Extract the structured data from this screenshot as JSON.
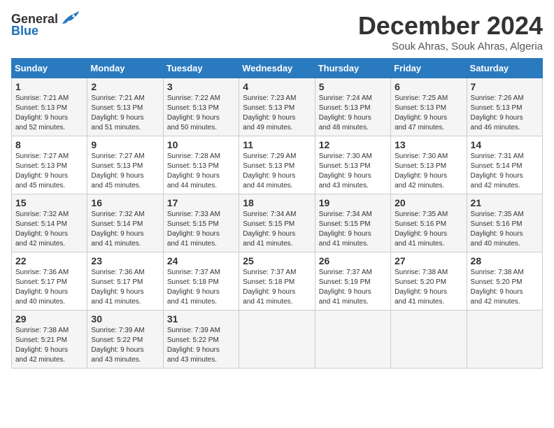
{
  "header": {
    "logo_general": "General",
    "logo_blue": "Blue",
    "month": "December 2024",
    "location": "Souk Ahras, Souk Ahras, Algeria"
  },
  "calendar": {
    "weekdays": [
      "Sunday",
      "Monday",
      "Tuesday",
      "Wednesday",
      "Thursday",
      "Friday",
      "Saturday"
    ],
    "weeks": [
      [
        {
          "day": "",
          "info": ""
        },
        {
          "day": "2",
          "info": "Sunrise: 7:21 AM\nSunset: 5:13 PM\nDaylight: 9 hours\nand 51 minutes."
        },
        {
          "day": "3",
          "info": "Sunrise: 7:22 AM\nSunset: 5:13 PM\nDaylight: 9 hours\nand 50 minutes."
        },
        {
          "day": "4",
          "info": "Sunrise: 7:23 AM\nSunset: 5:13 PM\nDaylight: 9 hours\nand 49 minutes."
        },
        {
          "day": "5",
          "info": "Sunrise: 7:24 AM\nSunset: 5:13 PM\nDaylight: 9 hours\nand 48 minutes."
        },
        {
          "day": "6",
          "info": "Sunrise: 7:25 AM\nSunset: 5:13 PM\nDaylight: 9 hours\nand 47 minutes."
        },
        {
          "day": "7",
          "info": "Sunrise: 7:26 AM\nSunset: 5:13 PM\nDaylight: 9 hours\nand 46 minutes."
        }
      ],
      [
        {
          "day": "1",
          "info": "Sunrise: 7:21 AM\nSunset: 5:13 PM\nDaylight: 9 hours\nand 52 minutes."
        },
        {
          "day": "",
          "info": ""
        },
        {
          "day": "",
          "info": ""
        },
        {
          "day": "",
          "info": ""
        },
        {
          "day": "",
          "info": ""
        },
        {
          "day": "",
          "info": ""
        },
        {
          "day": "",
          "info": ""
        }
      ],
      [
        {
          "day": "8",
          "info": "Sunrise: 7:27 AM\nSunset: 5:13 PM\nDaylight: 9 hours\nand 45 minutes."
        },
        {
          "day": "9",
          "info": "Sunrise: 7:27 AM\nSunset: 5:13 PM\nDaylight: 9 hours\nand 45 minutes."
        },
        {
          "day": "10",
          "info": "Sunrise: 7:28 AM\nSunset: 5:13 PM\nDaylight: 9 hours\nand 44 minutes."
        },
        {
          "day": "11",
          "info": "Sunrise: 7:29 AM\nSunset: 5:13 PM\nDaylight: 9 hours\nand 44 minutes."
        },
        {
          "day": "12",
          "info": "Sunrise: 7:30 AM\nSunset: 5:13 PM\nDaylight: 9 hours\nand 43 minutes."
        },
        {
          "day": "13",
          "info": "Sunrise: 7:30 AM\nSunset: 5:13 PM\nDaylight: 9 hours\nand 42 minutes."
        },
        {
          "day": "14",
          "info": "Sunrise: 7:31 AM\nSunset: 5:14 PM\nDaylight: 9 hours\nand 42 minutes."
        }
      ],
      [
        {
          "day": "15",
          "info": "Sunrise: 7:32 AM\nSunset: 5:14 PM\nDaylight: 9 hours\nand 42 minutes."
        },
        {
          "day": "16",
          "info": "Sunrise: 7:32 AM\nSunset: 5:14 PM\nDaylight: 9 hours\nand 41 minutes."
        },
        {
          "day": "17",
          "info": "Sunrise: 7:33 AM\nSunset: 5:15 PM\nDaylight: 9 hours\nand 41 minutes."
        },
        {
          "day": "18",
          "info": "Sunrise: 7:34 AM\nSunset: 5:15 PM\nDaylight: 9 hours\nand 41 minutes."
        },
        {
          "day": "19",
          "info": "Sunrise: 7:34 AM\nSunset: 5:15 PM\nDaylight: 9 hours\nand 41 minutes."
        },
        {
          "day": "20",
          "info": "Sunrise: 7:35 AM\nSunset: 5:16 PM\nDaylight: 9 hours\nand 41 minutes."
        },
        {
          "day": "21",
          "info": "Sunrise: 7:35 AM\nSunset: 5:16 PM\nDaylight: 9 hours\nand 40 minutes."
        }
      ],
      [
        {
          "day": "22",
          "info": "Sunrise: 7:36 AM\nSunset: 5:17 PM\nDaylight: 9 hours\nand 40 minutes."
        },
        {
          "day": "23",
          "info": "Sunrise: 7:36 AM\nSunset: 5:17 PM\nDaylight: 9 hours\nand 41 minutes."
        },
        {
          "day": "24",
          "info": "Sunrise: 7:37 AM\nSunset: 5:18 PM\nDaylight: 9 hours\nand 41 minutes."
        },
        {
          "day": "25",
          "info": "Sunrise: 7:37 AM\nSunset: 5:18 PM\nDaylight: 9 hours\nand 41 minutes."
        },
        {
          "day": "26",
          "info": "Sunrise: 7:37 AM\nSunset: 5:19 PM\nDaylight: 9 hours\nand 41 minutes."
        },
        {
          "day": "27",
          "info": "Sunrise: 7:38 AM\nSunset: 5:20 PM\nDaylight: 9 hours\nand 41 minutes."
        },
        {
          "day": "28",
          "info": "Sunrise: 7:38 AM\nSunset: 5:20 PM\nDaylight: 9 hours\nand 42 minutes."
        }
      ],
      [
        {
          "day": "29",
          "info": "Sunrise: 7:38 AM\nSunset: 5:21 PM\nDaylight: 9 hours\nand 42 minutes."
        },
        {
          "day": "30",
          "info": "Sunrise: 7:39 AM\nSunset: 5:22 PM\nDaylight: 9 hours\nand 43 minutes."
        },
        {
          "day": "31",
          "info": "Sunrise: 7:39 AM\nSunset: 5:22 PM\nDaylight: 9 hours\nand 43 minutes."
        },
        {
          "day": "",
          "info": ""
        },
        {
          "day": "",
          "info": ""
        },
        {
          "day": "",
          "info": ""
        },
        {
          "day": "",
          "info": ""
        }
      ]
    ]
  }
}
